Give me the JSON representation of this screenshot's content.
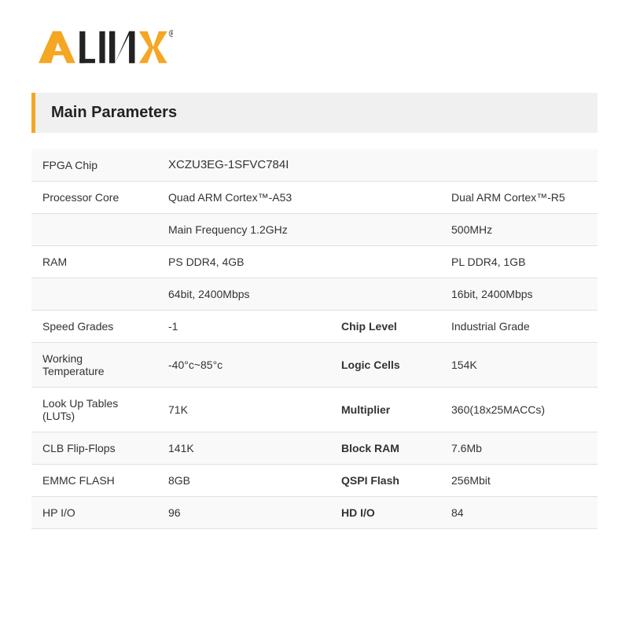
{
  "logo": {
    "alt": "ALINX"
  },
  "section": {
    "title": "Main Parameters"
  },
  "rows": [
    {
      "type": "single",
      "label": "FPGA Chip",
      "value": "XCZU3EG-1SFVC784I",
      "label2": "",
      "value2": ""
    },
    {
      "type": "double",
      "label": "Processor Core",
      "value": "Quad ARM Cortex™-A53",
      "label2": "",
      "value2": "Dual ARM Cortex™-R5"
    },
    {
      "type": "double-noLabel",
      "label": "",
      "value": "Main Frequency 1.2GHz",
      "label2": "",
      "value2": "500MHz"
    },
    {
      "type": "double",
      "label": "RAM",
      "value": "PS DDR4, 4GB",
      "label2": "",
      "value2": "PL DDR4, 1GB"
    },
    {
      "type": "double-noLabel",
      "label": "",
      "value": "64bit, 2400Mbps",
      "label2": "",
      "value2": "16bit, 2400Mbps"
    },
    {
      "type": "double",
      "label": "Speed Grades",
      "value": "-1",
      "label2": "Chip Level",
      "value2": "Industrial Grade"
    },
    {
      "type": "double",
      "label": "Working Temperature",
      "value": "-40°c~85°c",
      "label2": "Logic Cells",
      "value2": "154K"
    },
    {
      "type": "double",
      "label": "Look Up Tables (LUTs)",
      "value": "71K",
      "label2": "Multiplier",
      "value2": "360(18x25MACCs)"
    },
    {
      "type": "double",
      "label": "CLB Flip-Flops",
      "value": "141K",
      "label2": "Block RAM",
      "value2": "7.6Mb"
    },
    {
      "type": "double",
      "label": "EMMC FLASH",
      "value": "8GB",
      "label2": "QSPI Flash",
      "value2": "256Mbit"
    },
    {
      "type": "double",
      "label": "HP I/O",
      "value": "96",
      "label2": "HD I/O",
      "value2": "84"
    }
  ],
  "bold_labels2": [
    "Multiplier",
    "Block RAM",
    "Logic Cells",
    "Chip Level",
    "QSPI Flash",
    "HD I/O"
  ]
}
